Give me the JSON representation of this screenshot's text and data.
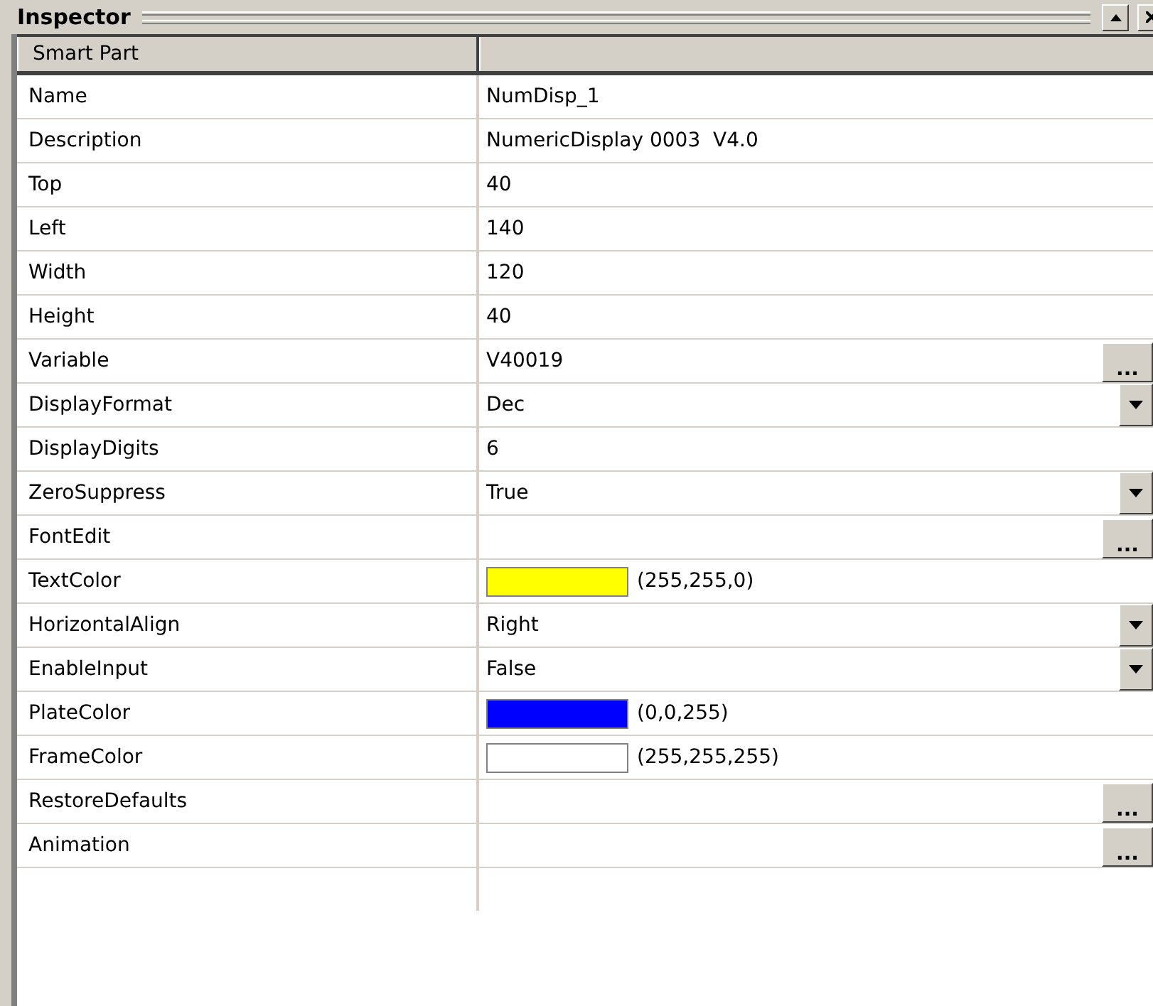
{
  "panel": {
    "title": "Inspector"
  },
  "table": {
    "header": "Smart Part",
    "rows": [
      {
        "name": "Name",
        "kind": "text",
        "value": "NumDisp_1"
      },
      {
        "name": "Description",
        "kind": "text",
        "value": "NumericDisplay 0003  V4.0"
      },
      {
        "name": "Top",
        "kind": "text",
        "value": "40"
      },
      {
        "name": "Left",
        "kind": "text",
        "value": "140"
      },
      {
        "name": "Width",
        "kind": "text",
        "value": "120"
      },
      {
        "name": "Height",
        "kind": "text",
        "value": "40"
      },
      {
        "name": "Variable",
        "kind": "button",
        "value": "V40019",
        "button_label": "..."
      },
      {
        "name": "DisplayFormat",
        "kind": "dropdown",
        "value": "Dec"
      },
      {
        "name": "DisplayDigits",
        "kind": "text",
        "value": "6"
      },
      {
        "name": "ZeroSuppress",
        "kind": "dropdown",
        "value": "True"
      },
      {
        "name": "FontEdit",
        "kind": "button",
        "button_label": "..."
      },
      {
        "name": "TextColor",
        "kind": "color",
        "color": "#ffff00",
        "value": "(255,255,0)"
      },
      {
        "name": "HorizontalAlign",
        "kind": "dropdown",
        "value": "Right"
      },
      {
        "name": "EnableInput",
        "kind": "dropdown",
        "value": "False"
      },
      {
        "name": "PlateColor",
        "kind": "color",
        "color": "#0000ff",
        "value": "(0,0,255)"
      },
      {
        "name": "FrameColor",
        "kind": "color",
        "color": "#ffffff",
        "value": "(255,255,255)"
      },
      {
        "name": "RestoreDefaults",
        "kind": "button",
        "button_label": "..."
      },
      {
        "name": "Animation",
        "kind": "button",
        "button_label": "..."
      }
    ]
  }
}
